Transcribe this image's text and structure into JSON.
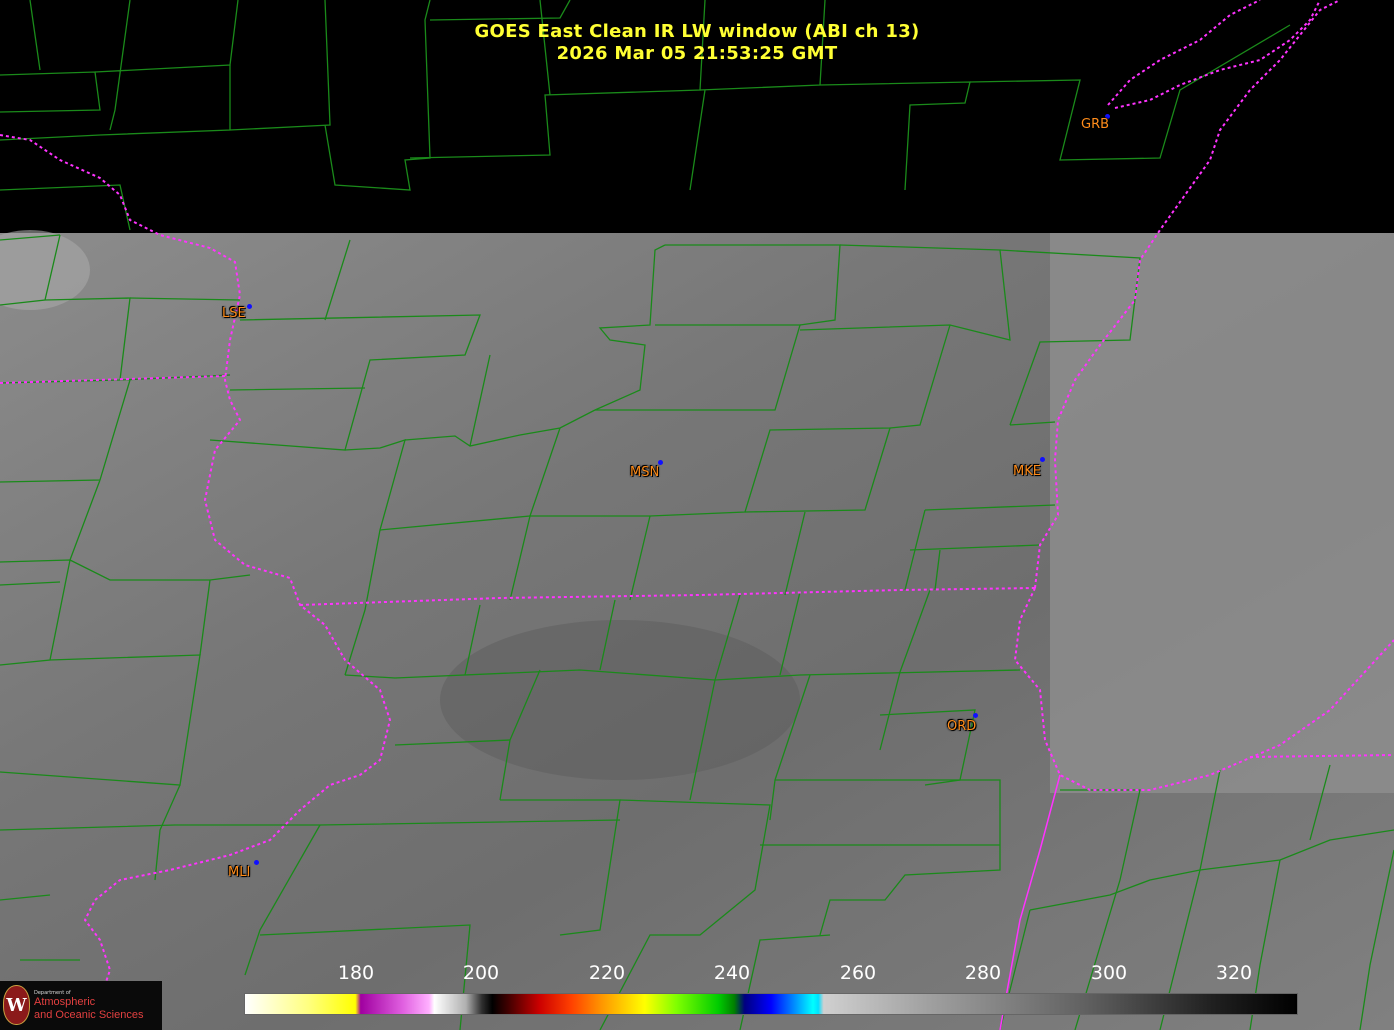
{
  "title": {
    "line1": "GOES East Clean IR LW window (ABI ch 13)",
    "line2": "2026 Mar 05  21:53:25 GMT"
  },
  "cities": [
    {
      "code": "GRB"
    },
    {
      "code": "LSE"
    },
    {
      "code": "MSN"
    },
    {
      "code": "MKE"
    },
    {
      "code": "ORD"
    },
    {
      "code": "MLI"
    }
  ],
  "colorbar": {
    "ticks": [
      "180",
      "200",
      "220",
      "240",
      "260",
      "280",
      "300",
      "320"
    ]
  },
  "logo": {
    "seal_letter": "W",
    "department": "Department of",
    "line1": "Atmospheric",
    "line2": "and Oceanic Sciences"
  },
  "colors": {
    "county_lines": "#1a8a1a",
    "state_lines": "#ff33ff",
    "title": "#ffff33",
    "city_label": "#ff8c1a",
    "city_dot": "#1010ff"
  }
}
